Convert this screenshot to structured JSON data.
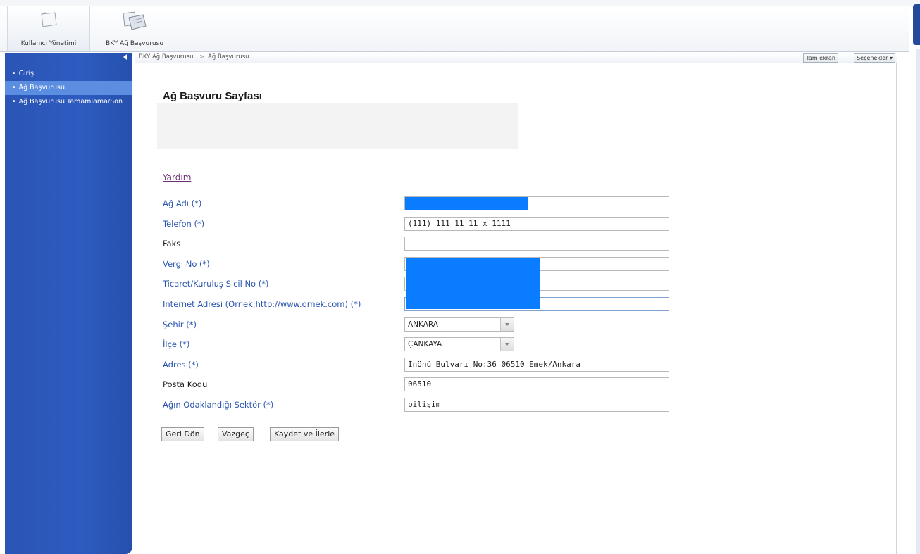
{
  "ribbon": {
    "buttons": [
      {
        "label": "Kullanıcı Yönetimi",
        "icon": "folder-icon"
      },
      {
        "label": "BKY Ağ Başvurusu",
        "icon": "documents-icon"
      }
    ]
  },
  "sidebar": {
    "items": [
      {
        "label": "Giriş",
        "active": false
      },
      {
        "label": "Ağ Başvurusu",
        "active": true
      },
      {
        "label": "Ağ Başvurusu Tamamlama/Son",
        "active": false
      }
    ]
  },
  "breadcrumb": {
    "items": [
      "BKY Ağ Başvurusu",
      "Ağ Başvurusu"
    ],
    "separator": ">"
  },
  "toolbar": {
    "fullscreen_label": "Tam ekran",
    "options_label": "Seçenekler ▾"
  },
  "page": {
    "title": "Ağ Başvuru Sayfası",
    "help_link": "Yardım"
  },
  "form": {
    "network_name": {
      "label": "Ağ Adı (*)",
      "value": ""
    },
    "phone": {
      "label": "Telefon (*)",
      "value": "(111) 111 11 11 x 1111"
    },
    "fax": {
      "label": "Faks",
      "value": ""
    },
    "tax_no": {
      "label": "Vergi No (*)",
      "value": ""
    },
    "registry_no": {
      "label": "Ticaret/Kuruluş Sicil No (*)",
      "value": ""
    },
    "website": {
      "label": "Internet Adresi (Ornek:http://www.ornek.com) (*)",
      "value": ""
    },
    "city": {
      "label": "Şehir (*)",
      "value": "ANKARA"
    },
    "district": {
      "label": "İlçe (*)",
      "value": "ÇANKAYA"
    },
    "address": {
      "label": "Adres (*)",
      "value": "İnönü Bulvarı No:36 06510 Emek/Ankara"
    },
    "postal_code": {
      "label": "Posta Kodu",
      "value": "06510"
    },
    "sector": {
      "label": "Ağın Odaklandığı Sektör (*)",
      "value": "bilişim"
    }
  },
  "buttons": {
    "back": "Geri Dön",
    "cancel": "Vazgeç",
    "save_next": "Kaydet ve İlerle"
  },
  "colors": {
    "sidebar": "#2d5bc0",
    "sidebar_active": "#5b8de0",
    "required_label": "#2a55b0",
    "redaction": "#0a7cff"
  }
}
